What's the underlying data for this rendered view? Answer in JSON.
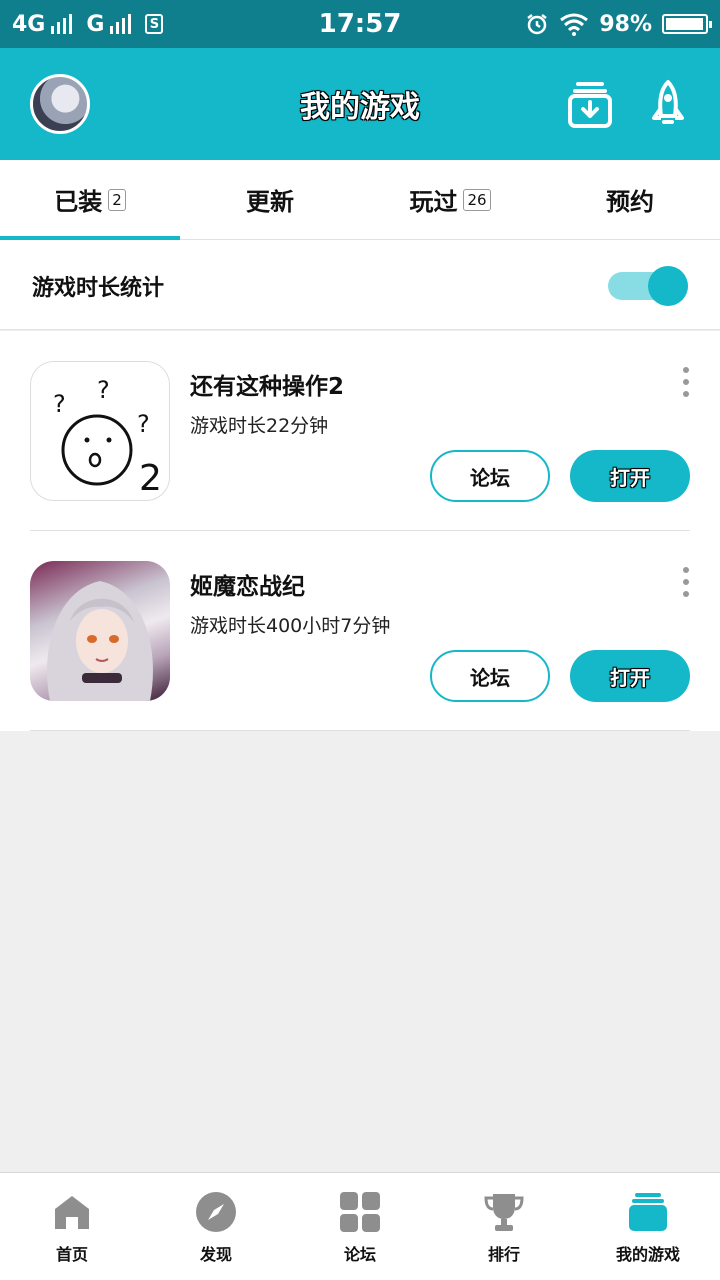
{
  "status_bar": {
    "network1": "4G",
    "network2": "G",
    "time": "17:57",
    "battery": "98%",
    "battery_level": 0.98
  },
  "header": {
    "title": "我的游戏",
    "accent_color": "#14b8c8"
  },
  "tabs": [
    {
      "label": "已装",
      "badge": "2",
      "active": true
    },
    {
      "label": "更新",
      "badge": "",
      "active": false
    },
    {
      "label": "玩过",
      "badge": "26",
      "active": false
    },
    {
      "label": "预约",
      "badge": "",
      "active": false
    }
  ],
  "stats": {
    "label": "游戏时长统计",
    "toggle_on": true
  },
  "games": [
    {
      "name": "还有这种操作2",
      "playtime": "游戏时长22分钟",
      "forum_label": "论坛",
      "open_label": "打开"
    },
    {
      "name": "姬魔恋战纪",
      "playtime": "游戏时长400小时7分钟",
      "forum_label": "论坛",
      "open_label": "打开"
    }
  ],
  "bottom_nav": [
    {
      "label": "首页",
      "icon": "home-icon",
      "active": false
    },
    {
      "label": "发现",
      "icon": "compass-icon",
      "active": false
    },
    {
      "label": "论坛",
      "icon": "grid-icon",
      "active": false
    },
    {
      "label": "排行",
      "icon": "trophy-icon",
      "active": false
    },
    {
      "label": "我的游戏",
      "icon": "my-games-icon",
      "active": true
    }
  ]
}
